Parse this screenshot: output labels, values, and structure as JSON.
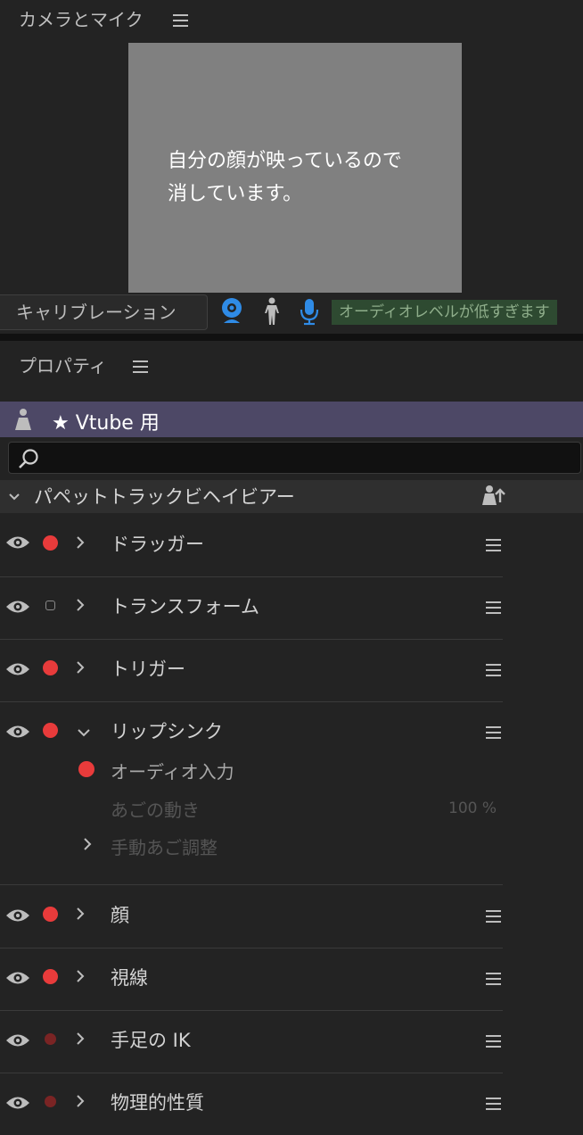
{
  "camera_panel": {
    "title": "カメラとマイク",
    "preview_message_line1": "自分の顔が映っているので",
    "preview_message_line2": "消しています。",
    "calibrate_label": "キャリブレーション",
    "audio_status": "オーディオレベルが低すぎます",
    "colors": {
      "preview_bg": "#808080",
      "icon_blue": "#2f8be6",
      "status_bg": "#2e4a31"
    }
  },
  "properties_panel": {
    "title": "プロパティ",
    "puppet_name": "★ Vtube 用",
    "search": {
      "value": "",
      "placeholder": ""
    },
    "section_label": "パペットトラックビヘイビアー",
    "behaviors": [
      {
        "name": "ドラッガー",
        "state": "on"
      },
      {
        "name": "トランスフォーム",
        "state": "hollow"
      },
      {
        "name": "トリガー",
        "state": "on"
      },
      {
        "name": "リップシンク",
        "state": "on",
        "expanded": true
      },
      {
        "name": "顔",
        "state": "on"
      },
      {
        "name": "視線",
        "state": "on"
      },
      {
        "name": "手足の IK",
        "state": "dim"
      },
      {
        "name": "物理的性質",
        "state": "dim"
      }
    ],
    "lipsync": {
      "audio_input": "オーディオ入力",
      "jaw_motion": "あごの動き",
      "jaw_value": "100 %",
      "manual_jaw": "手動あご調整"
    }
  }
}
